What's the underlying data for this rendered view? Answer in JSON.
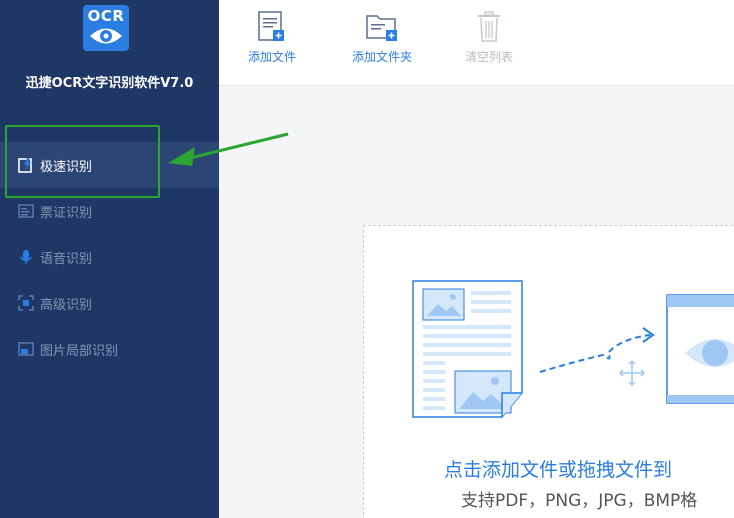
{
  "app": {
    "logo_text": "OCR",
    "title": "迅捷OCR文字识别软件V7.0"
  },
  "sidebar": {
    "items": [
      {
        "label": "极速识别",
        "icon": "fast-recognize-icon",
        "active": true
      },
      {
        "label": "票证识别",
        "icon": "ticket-icon",
        "active": false
      },
      {
        "label": "语音识别",
        "icon": "microphone-icon",
        "active": false
      },
      {
        "label": "高级识别",
        "icon": "scan-brackets-icon",
        "active": false
      },
      {
        "label": "图片局部识别",
        "icon": "image-partial-icon",
        "active": false
      }
    ]
  },
  "toolbar": {
    "add_file": "添加文件",
    "add_folder": "添加文件夹",
    "clear_list": "清空列表"
  },
  "dropzone": {
    "main_text": "点击添加文件或拖拽文件到",
    "sub_text": "支持PDF，PNG，JPG，BMP格"
  },
  "colors": {
    "sidebar_bg": "#1f3765",
    "accent": "#2b7de1",
    "highlight": "#2aa52f"
  }
}
